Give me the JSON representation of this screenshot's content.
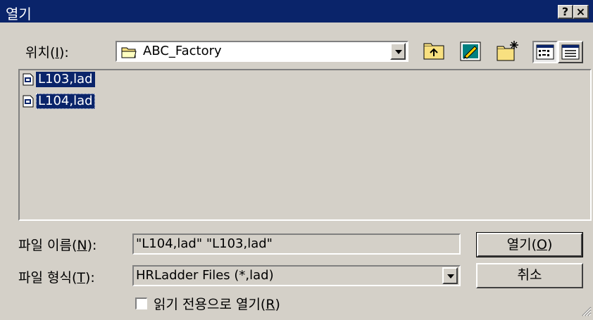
{
  "window": {
    "title": "열기",
    "help_label": "?",
    "close_label": "×"
  },
  "location": {
    "label_prefix": "위치(",
    "label_key": "I",
    "label_suffix": "):",
    "value": "ABC_Factory"
  },
  "toolbar": {
    "up_icon": "folder-up-icon",
    "desktop_icon": "desktop-icon",
    "new_folder_icon": "new-folder-icon",
    "list_view_icon": "list-view-icon",
    "details_view_icon": "details-view-icon"
  },
  "files": [
    {
      "name": "L103,lad"
    },
    {
      "name": "L104,lad"
    }
  ],
  "filename": {
    "label_prefix": "파일 이름(",
    "label_key": "N",
    "label_suffix": "):",
    "value": "\"L104,lad\" \"L103,lad\""
  },
  "filetype": {
    "label_prefix": "파일 형식(",
    "label_key": "T",
    "label_suffix": "):",
    "value": "HRLadder Files (*,lad)"
  },
  "readonly": {
    "label_prefix": "읽기 전용으로 열기(",
    "label_key": "R",
    "label_suffix": ")",
    "checked": false
  },
  "buttons": {
    "open_prefix": "열기(",
    "open_key": "O",
    "open_suffix": ")",
    "cancel": "취소"
  },
  "colors": {
    "titlebar": "#0a246a",
    "face": "#d4d0c8",
    "selection": "#0a246a"
  }
}
